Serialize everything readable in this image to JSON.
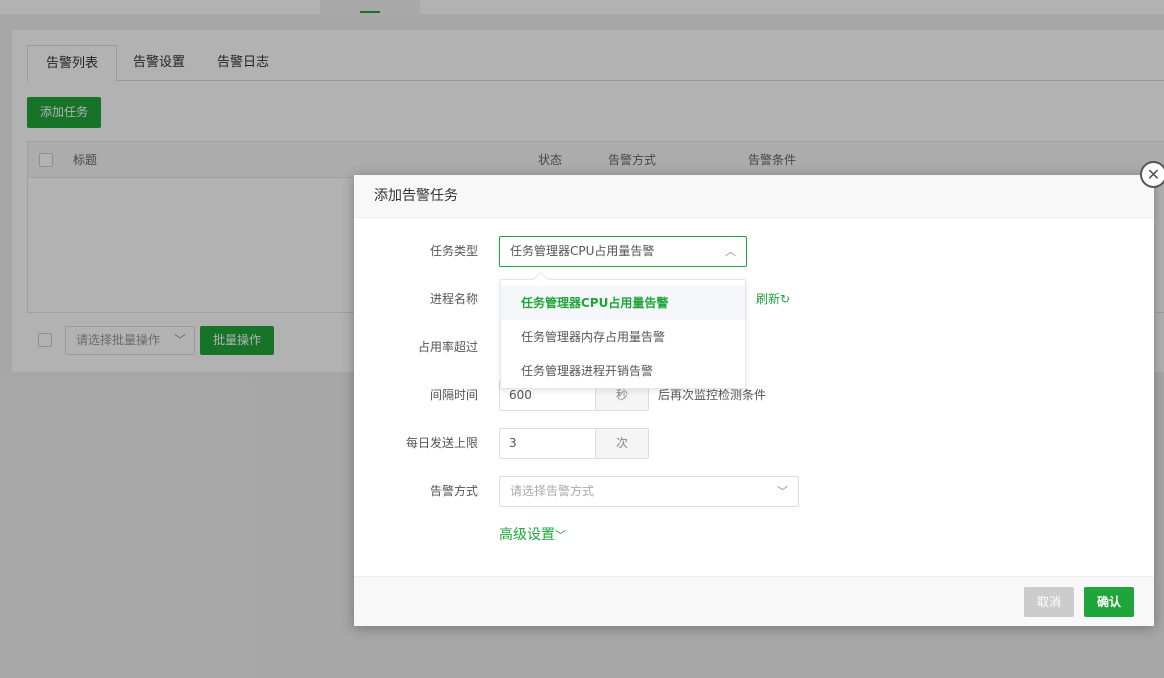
{
  "tabs": [
    "告警列表",
    "告警设置",
    "告警日志"
  ],
  "list": {
    "add_button": "添加任务",
    "columns": [
      "标题",
      "状态",
      "告警方式",
      "告警条件"
    ],
    "batch_placeholder": "请选择批量操作",
    "batch_button": "批量操作"
  },
  "modal": {
    "title": "添加告警任务",
    "task_type_label": "任务类型",
    "task_type_value": "任务管理器CPU占用量告警",
    "task_type_options": [
      "任务管理器CPU占用量告警",
      "任务管理器内存占用量告警",
      "任务管理器进程开销告警"
    ],
    "process_label": "进程名称",
    "refresh_label": "刷新",
    "usage_label": "占用率超过",
    "interval_label": "间隔时间",
    "interval_value": "600",
    "interval_unit": "秒",
    "interval_suffix": "后再次监控检测条件",
    "daily_label": "每日发送上限",
    "daily_value": "3",
    "daily_unit": "次",
    "method_label": "告警方式",
    "method_placeholder": "请选择告警方式",
    "advanced_label": "高级设置",
    "cancel_button": "取消",
    "confirm_button": "确认"
  },
  "colors": {
    "accent": "#20a53a"
  }
}
